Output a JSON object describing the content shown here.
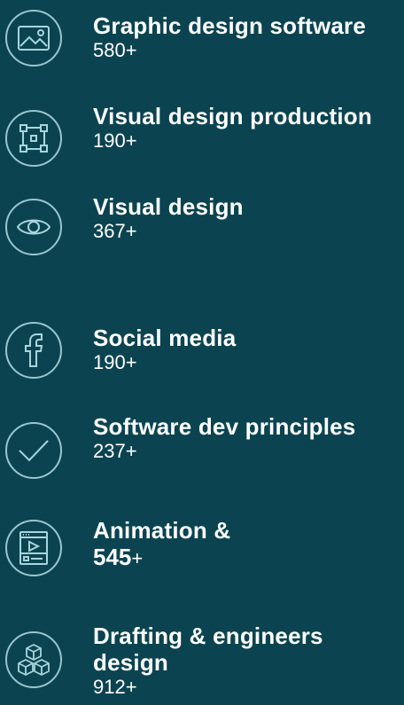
{
  "categories": [
    {
      "title": "Graphic design software",
      "count": "580+",
      "icon": "image-icon"
    },
    {
      "title": "Visual design production",
      "count": "190+",
      "icon": "vector-nodes-icon"
    },
    {
      "title": "Visual design",
      "count": "367+",
      "icon": "eye-icon"
    },
    {
      "title": "Social media",
      "count": "190+",
      "icon": "facebook-icon"
    },
    {
      "title": "Software dev principles",
      "count": "237+",
      "icon": "checkmark-icon"
    },
    {
      "title": "Animation &",
      "count_number": "545",
      "count_suffix": "+",
      "icon": "video-player-icon"
    },
    {
      "title": "Drafting & engineers design",
      "count": "912+",
      "icon": "cubes-icon"
    }
  ],
  "colors": {
    "background": "#0b4450",
    "icon_stroke": "#a8d5de",
    "text": "#ffffff"
  }
}
